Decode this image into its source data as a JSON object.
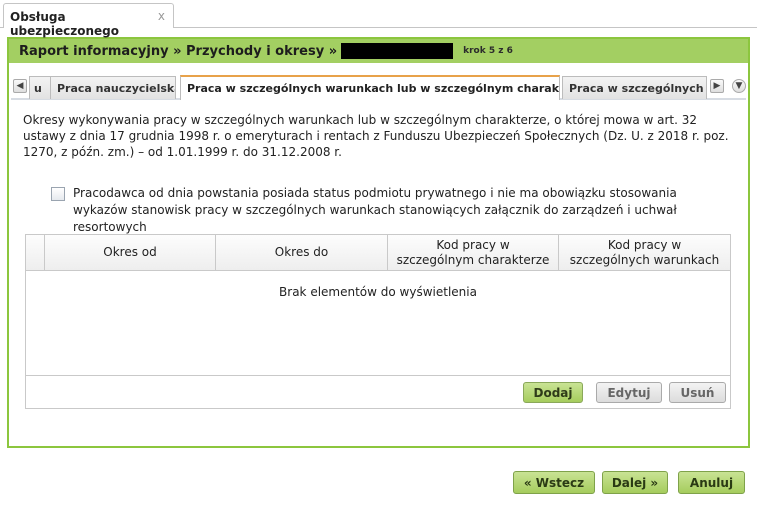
{
  "doc_tab": {
    "label": "Obsługa ubezpieczonego",
    "close": "x"
  },
  "header": {
    "title": "Raport informacyjny » Przychody i okresy »",
    "step": "krok 5 z 6"
  },
  "tabs": {
    "prev_arrow": "◀",
    "next_arrow": "▶",
    "menu_arrow": "▼",
    "items": [
      {
        "label": "u"
      },
      {
        "label": "Praca nauczycielska"
      },
      {
        "label": "Praca w szczególnych warunkach lub w szczególnym charakterze",
        "active": true
      },
      {
        "label": "Praca w szczególnych w"
      }
    ]
  },
  "description": "Okresy wykonywania pracy w szczególnych warunkach lub w szczególnym charakterze, o której mowa w art. 32 ustawy z dnia 17 grudnia 1998 r. o emeryturach i rentach z Funduszu Ubezpieczeń Społecznych (Dz. U. z 2018 r. poz. 1270, z późn. zm.) – od 1.01.1999 r. do 31.12.2008 r.",
  "checkbox": {
    "checked": false,
    "label": "Pracodawca od dnia powstania posiada status podmiotu prywatnego i nie ma obowiązku stosowania wykazów stanowisk pracy w szczególnych warunkach stanowiących załącznik do zarządzeń i uchwał resortowych"
  },
  "grid": {
    "columns": [
      "Okres od",
      "Okres do",
      "Kod pracy w szczególnym charakterze",
      "Kod pracy w szczególnych warunkach"
    ],
    "rows": [],
    "empty_text": "Brak elementów do wyświetlenia",
    "buttons": {
      "add": "Dodaj",
      "edit": "Edytuj",
      "delete": "Usuń"
    }
  },
  "wizard": {
    "back": "« Wstecz",
    "next": "Dalej »",
    "cancel": "Anuluj"
  }
}
